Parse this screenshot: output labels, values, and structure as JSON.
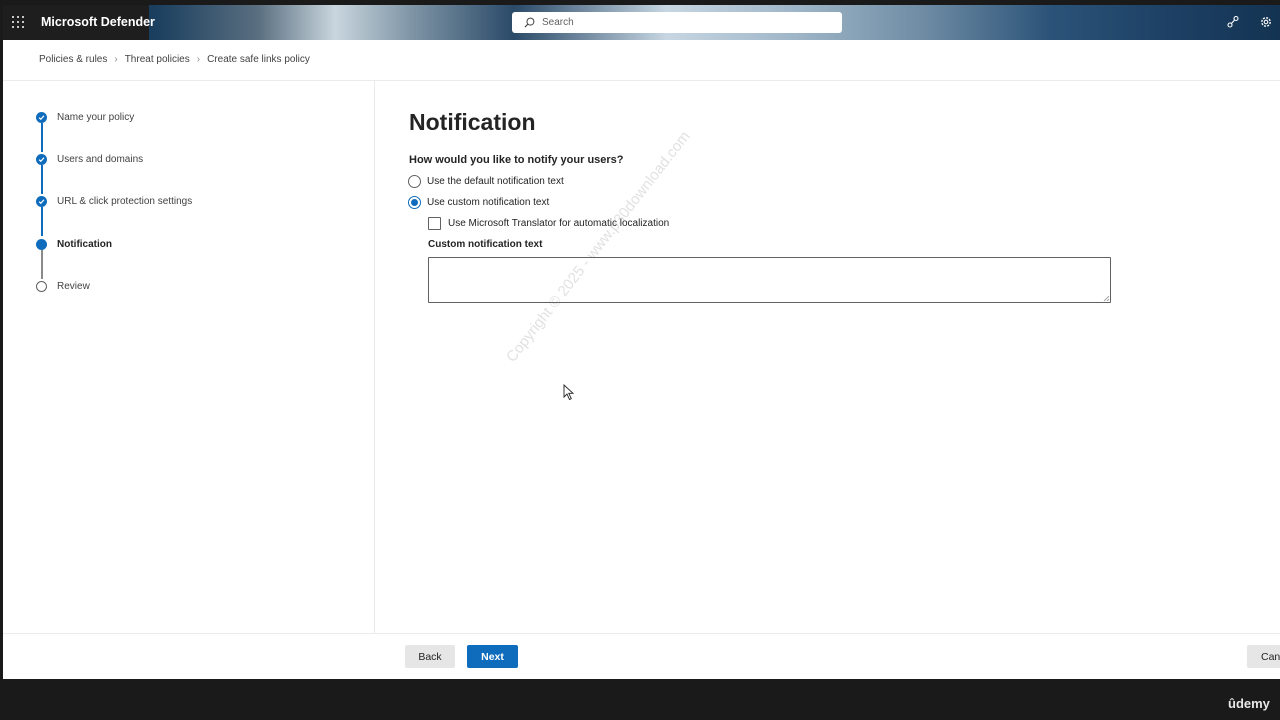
{
  "header": {
    "app_title": "Microsoft Defender",
    "search_placeholder": "Search",
    "icons": [
      "waffle-icon",
      "search-icon",
      "share-icon",
      "settings-icon"
    ]
  },
  "breadcrumb": {
    "items": [
      "Policies & rules",
      "Threat policies",
      "Create safe links policy"
    ]
  },
  "wizard": {
    "steps": [
      {
        "label": "Name your policy",
        "state": "done"
      },
      {
        "label": "Users and domains",
        "state": "done"
      },
      {
        "label": "URL & click protection settings",
        "state": "done"
      },
      {
        "label": "Notification",
        "state": "current"
      },
      {
        "label": "Review",
        "state": "todo"
      }
    ]
  },
  "main": {
    "title": "Notification",
    "question": "How would you like to notify your users?",
    "options": [
      {
        "label": "Use the default notification text",
        "selected": false
      },
      {
        "label": "Use custom notification text",
        "selected": true
      }
    ],
    "translator_checkbox": {
      "label": "Use Microsoft Translator for automatic localization",
      "checked": false
    },
    "custom_text_label": "Custom notification text",
    "custom_text_value": ""
  },
  "footer": {
    "back_label": "Back",
    "next_label": "Next",
    "cancel_label": "Cancel"
  },
  "watermark": "Copyright © 2025 - www.p30download.com",
  "video_brand": "ûdemy",
  "colors": {
    "accent": "#0f6cbd",
    "text": "#242424",
    "border": "#616161"
  }
}
